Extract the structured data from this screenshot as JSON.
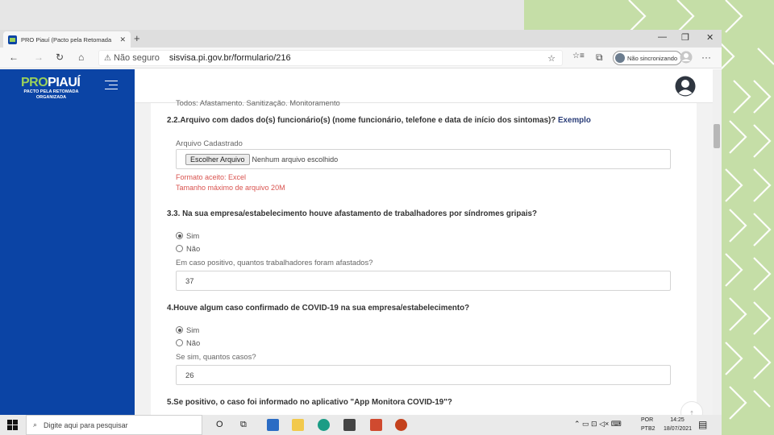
{
  "browser": {
    "tab_title": "PRO Piauí (Pacto pela Retomada",
    "tab_close": "✕",
    "new_tab": "+",
    "window_controls": {
      "minimize": "—",
      "restore": "❐",
      "close": "✕"
    },
    "nav": {
      "back": "←",
      "forward": "→",
      "reload": "↻",
      "lock": "⌂"
    },
    "address": {
      "warning_icon": "⚠",
      "not_secure": "Não seguro",
      "url": "sisvisa.pi.gov.br/formulario/216"
    },
    "toolbar_icons": {
      "favorite": "☆",
      "favorites_bar": "☆≡",
      "collections": "⧉",
      "profile": "◯",
      "more": "···"
    },
    "sync_label": "Não sincronizando"
  },
  "site": {
    "logo_pro": "PRO",
    "logo_name": "PIAUÍ",
    "logo_sub_1": "PACTO PELA RETOMADA",
    "logo_sub_2": "ORGANIZADA"
  },
  "form": {
    "cut_label": "Todos: Afastamento. Sanitização. Monitoramento",
    "q22_text": "2.2.Arquivo com dados do(s) funcionário(s) (nome funcionário, telefone e data de início dos sintomas)?",
    "q22_link": "Exemplo",
    "file_label": "Arquivo Cadastrado",
    "file_button": "Escolher Arquivo",
    "file_name": "Nenhum arquivo escolhido",
    "file_format": "Formato aceito: Excel",
    "file_max": "Tamanho máximo de arquivo 20M",
    "q33_text": "3.3. Na sua empresa/estabelecimento houve afastamento de trabalhadores por síndromes gripais?",
    "q33_yes": "Sim",
    "q33_no": "Não",
    "q33_followup": "Em caso positivo, quantos trabalhadores foram afastados?",
    "q33_value": "37",
    "q4_text": "4.Houve algum caso confirmado de COVID-19 na sua empresa/estabelecimento?",
    "q4_yes": "Sim",
    "q4_no": "Não",
    "q4_followup": "Se sim, quantos casos?",
    "q4_value": "26",
    "q5_text": "5.Se positivo, o caso foi informado no aplicativo \"App Monitora COVID-19\"?",
    "scroll_top_icon": "↑"
  },
  "taskbar": {
    "search_icon": "⌕",
    "search_placeholder": "Digite aqui para pesquisar",
    "cortana": "O",
    "task_view": "⧉",
    "tray_icons": "⌃  ▭  ⊡  ◁×  ⌨",
    "lang_1": "POR",
    "lang_2": "PTB2",
    "time": "14:25",
    "date": "18/07/2021",
    "notifications": "▤"
  }
}
